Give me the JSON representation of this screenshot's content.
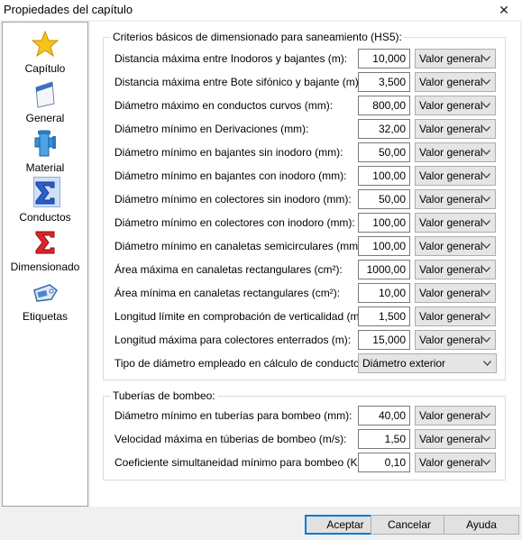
{
  "window": {
    "title": "Propiedades del capítulo",
    "close_glyph": "✕"
  },
  "sidebar": {
    "items": [
      {
        "label": "Capítulo",
        "icon": "star-icon"
      },
      {
        "label": "General",
        "icon": "panel-icon"
      },
      {
        "label": "Material",
        "icon": "pipe-icon"
      },
      {
        "label": "Conductos",
        "icon": "sigma-blue-icon",
        "selected": true
      },
      {
        "label": "Dimensionado",
        "icon": "sigma-red-icon"
      },
      {
        "label": "Etiquetas",
        "icon": "tag-icon"
      }
    ]
  },
  "criterios": {
    "legend": "Criterios básicos de dimensionado para saneamiento (HS5):",
    "rows": [
      {
        "label": "Distancia máxima entre Inodoros y bajantes (m):",
        "value": "10,000",
        "select": "Valor general"
      },
      {
        "label": "Distancia máxima entre Bote sifónico y bajante (m):",
        "value": "3,500",
        "select": "Valor general"
      },
      {
        "label": "Diámetro máximo en conductos curvos (mm):",
        "value": "800,00",
        "select": "Valor general"
      },
      {
        "label": "Diámetro mínimo en Derivaciones (mm):",
        "value": "32,00",
        "select": "Valor general"
      },
      {
        "label": "Diámetro mínimo en bajantes sin inodoro (mm):",
        "value": "50,00",
        "select": "Valor general"
      },
      {
        "label": "Diámetro mínimo en bajantes con inodoro (mm):",
        "value": "100,00",
        "select": "Valor general"
      },
      {
        "label": "Diámetro mínimo en colectores sin inodoro (mm):",
        "value": "50,00",
        "select": "Valor general"
      },
      {
        "label": "Diámetro mínimo en colectores con inodoro (mm):",
        "value": "100,00",
        "select": "Valor general"
      },
      {
        "label": "Diámetro mínimo en canaletas semicirculares (mm):",
        "value": "100,00",
        "select": "Valor general"
      },
      {
        "label": "Área máxima en canaletas rectangulares (cm²):",
        "value": "1000,00",
        "select": "Valor general"
      },
      {
        "label": "Área mínima en canaletas rectangulares (cm²):",
        "value": "10,00",
        "select": "Valor general"
      },
      {
        "label": "Longitud límite en comprobación de verticalidad (m):",
        "value": "1,500",
        "select": "Valor general"
      },
      {
        "label": "Longitud máxima para colectores enterrados (m):",
        "value": "15,000",
        "select": "Valor general"
      }
    ],
    "tipo": {
      "label": "Tipo de diámetro empleado en cálculo de conductos:",
      "select": "Diámetro exterior"
    }
  },
  "bombeo": {
    "legend": "Tuberías de bombeo:",
    "rows": [
      {
        "label": "Diámetro mínimo en tuberías para bombeo (mm):",
        "value": "40,00",
        "select": "Valor general"
      },
      {
        "label": "Velocidad máxima en túberias de bombeo (m/s):",
        "value": "1,50",
        "select": "Valor general"
      },
      {
        "label": "Coeficiente simultaneidad mínimo para bombeo (Ks)",
        "value": "0,10",
        "select": "Valor general"
      }
    ]
  },
  "buttons": {
    "accept": "Aceptar",
    "cancel": "Cancelar",
    "help": "Ayuda"
  },
  "colors": {
    "accent": "#0078d7",
    "panel": "#ffffff",
    "dialog": "#f0f0f0"
  }
}
